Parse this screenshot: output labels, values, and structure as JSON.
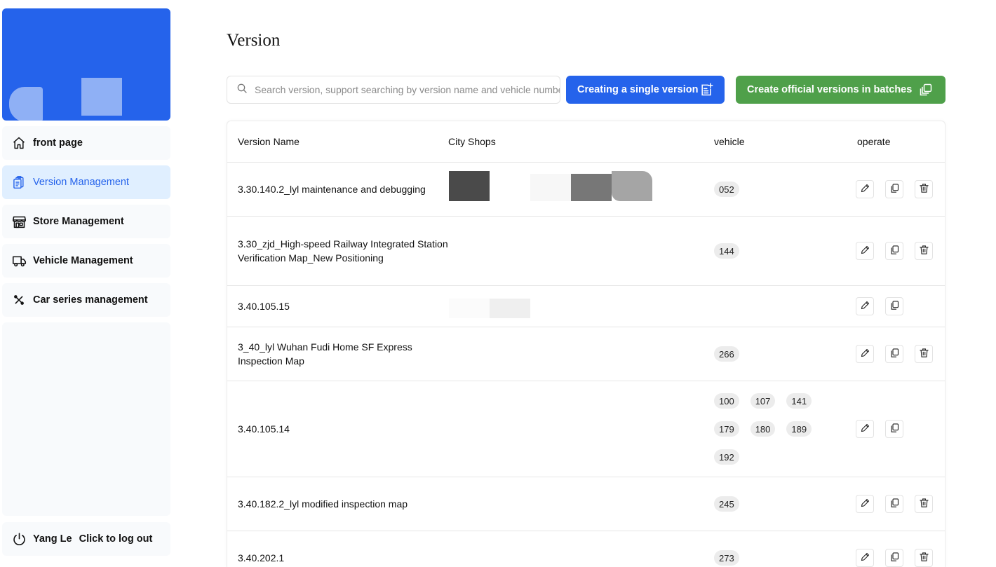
{
  "sidebar": {
    "items": [
      {
        "label": "front page",
        "icon": "home-icon"
      },
      {
        "label": "Version Management",
        "icon": "clipboard-icon"
      },
      {
        "label": "Store Management",
        "icon": "store-icon"
      },
      {
        "label": "Vehicle Management",
        "icon": "truck-icon"
      },
      {
        "label": "Car series management",
        "icon": "tools-icon"
      }
    ],
    "active_item": "Version Management",
    "user_name": "Yang Le",
    "logout_label": "Click to log out"
  },
  "page": {
    "title": "Version"
  },
  "toolbar": {
    "search_placeholder": "Search version, support searching by version name and vehicle number",
    "create_single_label": "Creating a single version",
    "create_batch_label": "Create official versions in batches"
  },
  "table": {
    "headers": [
      "Version Name",
      "City Shops",
      "vehicle",
      "operate"
    ],
    "rows": [
      {
        "name": "3.30.140.2_lyl maintenance and debugging",
        "vehicles": [
          "052"
        ],
        "can_delete": true
      },
      {
        "name": "3.30_zjd_High-speed Railway Integrated Station Verification Map_New Positioning",
        "vehicles": [
          "144"
        ],
        "can_delete": true
      },
      {
        "name": "3.40.105.15",
        "vehicles": [],
        "can_delete": false
      },
      {
        "name": "3_40_lyl Wuhan Fudi Home SF Express Inspection Map",
        "vehicles": [
          "266"
        ],
        "can_delete": true
      },
      {
        "name": "3.40.105.14",
        "vehicles": [
          "100",
          "107",
          "141",
          "179",
          "180",
          "189",
          "192"
        ],
        "can_delete": false
      },
      {
        "name": "3.40.182.2_lyl modified inspection map",
        "vehicles": [
          "245"
        ],
        "can_delete": true
      },
      {
        "name": "3.40.202.1",
        "vehicles": [
          "273"
        ],
        "can_delete": true
      }
    ]
  },
  "colors": {
    "primary": "#2563eb",
    "success": "#4fa04a",
    "active_bg": "#e0efff"
  }
}
